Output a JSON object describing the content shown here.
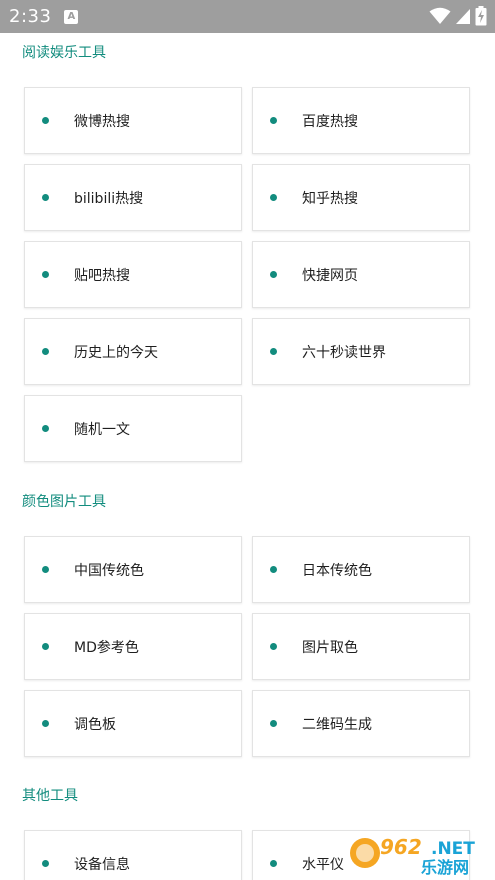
{
  "status_bar": {
    "time": "2:33",
    "a_icon": "A"
  },
  "sections": [
    {
      "title": "阅读娱乐工具",
      "items": [
        "微博热搜",
        "百度热搜",
        "bilibili热搜",
        "知乎热搜",
        "贴吧热搜",
        "快捷网页",
        "历史上的今天",
        "六十秒读世界",
        "随机一文"
      ]
    },
    {
      "title": "颜色图片工具",
      "items": [
        "中国传统色",
        "日本传统色",
        "MD参考色",
        "图片取色",
        "调色板",
        "二维码生成"
      ]
    },
    {
      "title": "其他工具",
      "items": [
        "设备信息",
        "水平仪"
      ]
    }
  ],
  "watermark": {
    "num": "962",
    "suffix": ".NET",
    "text": "乐游网"
  },
  "colors": {
    "accent": "#128c7e",
    "status_bar": "#9e9e9e"
  },
  "icons": [
    "wifi-icon",
    "signal-icon",
    "battery-charging-icon",
    "dot-icon"
  ]
}
